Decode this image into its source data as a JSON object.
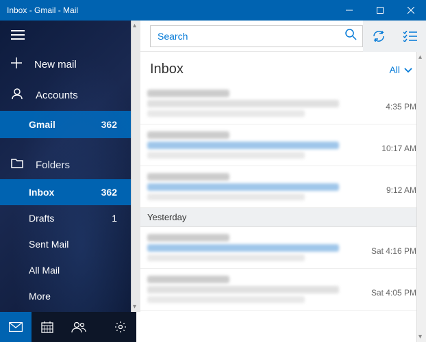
{
  "titlebar": {
    "title": "Inbox - Gmail - Mail"
  },
  "sidebar": {
    "new_mail": "New mail",
    "accounts_label": "Accounts",
    "account": {
      "name": "Gmail",
      "count": "362"
    },
    "folders_label": "Folders",
    "folders": [
      {
        "name": "Inbox",
        "count": "362",
        "selected": true
      },
      {
        "name": "Drafts",
        "count": "1",
        "selected": false
      },
      {
        "name": "Sent Mail",
        "count": "",
        "selected": false
      },
      {
        "name": "All Mail",
        "count": "",
        "selected": false
      },
      {
        "name": "More",
        "count": "",
        "selected": false
      }
    ]
  },
  "search": {
    "placeholder": "Search"
  },
  "header": {
    "title": "Inbox",
    "filter": "All"
  },
  "groups": [
    {
      "label": "",
      "messages": [
        {
          "unread": false,
          "time": "4:35 PM"
        },
        {
          "unread": true,
          "time": "10:17 AM"
        },
        {
          "unread": true,
          "time": "9:12 AM"
        }
      ]
    },
    {
      "label": "Yesterday",
      "messages": [
        {
          "unread": true,
          "time": "Sat 4:16 PM"
        },
        {
          "unread": false,
          "time": "Sat 4:05 PM"
        }
      ]
    }
  ]
}
